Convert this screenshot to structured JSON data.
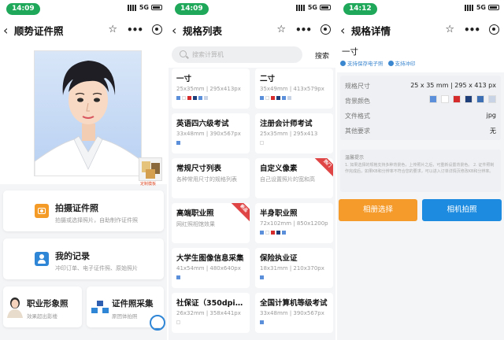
{
  "screen1": {
    "time": "14:09",
    "network": "5G",
    "title": "顺势证件照",
    "thumb_label": "定制模板",
    "menu": [
      {
        "title": "拍摄证件照",
        "sub": "拍摄或选择照片，自助制作证件照"
      },
      {
        "title": "我的记录",
        "sub": "冲印订单、电子证件照、原始照片"
      }
    ],
    "bottom": [
      {
        "title": "职业形象照",
        "sub": "效果超出影楼"
      },
      {
        "title": "证件照采集",
        "sub": "原团体拍照"
      }
    ]
  },
  "screen2": {
    "time": "14:09",
    "network": "5G",
    "title": "规格列表",
    "search_placeholder": "搜索计算机",
    "search_button": "搜索",
    "items": [
      {
        "title": "一寸",
        "sub": "25x35mm | 295x413px",
        "colors": [
          "#5b8fd9",
          "#ffffff",
          "#d62b2b",
          "#1f3f7a",
          "#5b8fd9",
          "#c8d3e6"
        ]
      },
      {
        "title": "二寸",
        "sub": "35x49mm | 413x579px",
        "colors": [
          "#5b8fd9",
          "#ffffff",
          "#d62b2b",
          "#1f3f7a",
          "#5b8fd9",
          "#c8d3e6"
        ]
      },
      {
        "title": "英语四六级考试",
        "sub": "33x48mm | 390x567px",
        "colors": [
          "#5b8fd9"
        ]
      },
      {
        "title": "注册会计师考试",
        "sub": "25x35mm | 295x413",
        "colors": [
          "#ffffff"
        ]
      },
      {
        "title": "常规尺寸列表",
        "sub": "各种常用尺寸的规格列表",
        "colors": []
      },
      {
        "title": "自定义像素",
        "sub": "自己设置照片的宽和高",
        "colors": [],
        "ribbon": "热门",
        "ribbon_color": "#e04545"
      },
      {
        "title": "高端职业照",
        "sub": "网红照相馆效果",
        "colors": [],
        "ribbon": "新品",
        "ribbon_color": "#e04545"
      },
      {
        "title": "半身职业照",
        "sub": "72x102mm | 850x1200px",
        "colors": [
          "#5b8fd9",
          "#ffffff",
          "#d62b2b",
          "#1f3f7a",
          "#5b8fd9"
        ]
      },
      {
        "title": "大学生图像信息采集",
        "sub": "41x54mm | 480x640px",
        "colors": [
          "#5b8fd9"
        ]
      },
      {
        "title": "保险执业证",
        "sub": "18x31mm | 210x370px",
        "colors": [
          "#5b8fd9"
        ]
      },
      {
        "title": "社保证（350dpi, ...",
        "sub": "26x32mm | 358x441px",
        "colors": [
          "#ffffff"
        ]
      },
      {
        "title": "全国计算机等级考试",
        "sub": "33x48mm | 390x567px",
        "colors": [
          "#5b8fd9"
        ]
      }
    ]
  },
  "screen3": {
    "time": "14:12",
    "network": "5G",
    "title": "规格详情",
    "spec_name": "一寸",
    "tags": [
      "支持保存电子照",
      "支持冲印"
    ],
    "rows": [
      {
        "label": "规格尺寸",
        "value": "25 x 35 mm | 295 x 413 px"
      },
      {
        "label": "背景颜色",
        "value": ""
      },
      {
        "label": "文件格式",
        "value": "jpg"
      },
      {
        "label": "其他要求",
        "value": "无"
      }
    ],
    "bg_colors": [
      "#5b8fd9",
      "#ffffff",
      "#d62b2b",
      "#1f3f7a",
      "#3d6fb5",
      "#c8d3e6"
    ],
    "tip_title": "温馨提示",
    "tip_text": "1. 如果选择的规格支持多种背景色，上传照片之后，可重新设置背景色。 2. 证件照制作完成后，如果KB和分辨率不符合您的要求，可以进入订单详情页修改KB和分辨率。",
    "btn_album": "相册选择",
    "btn_camera": "相机拍照"
  }
}
